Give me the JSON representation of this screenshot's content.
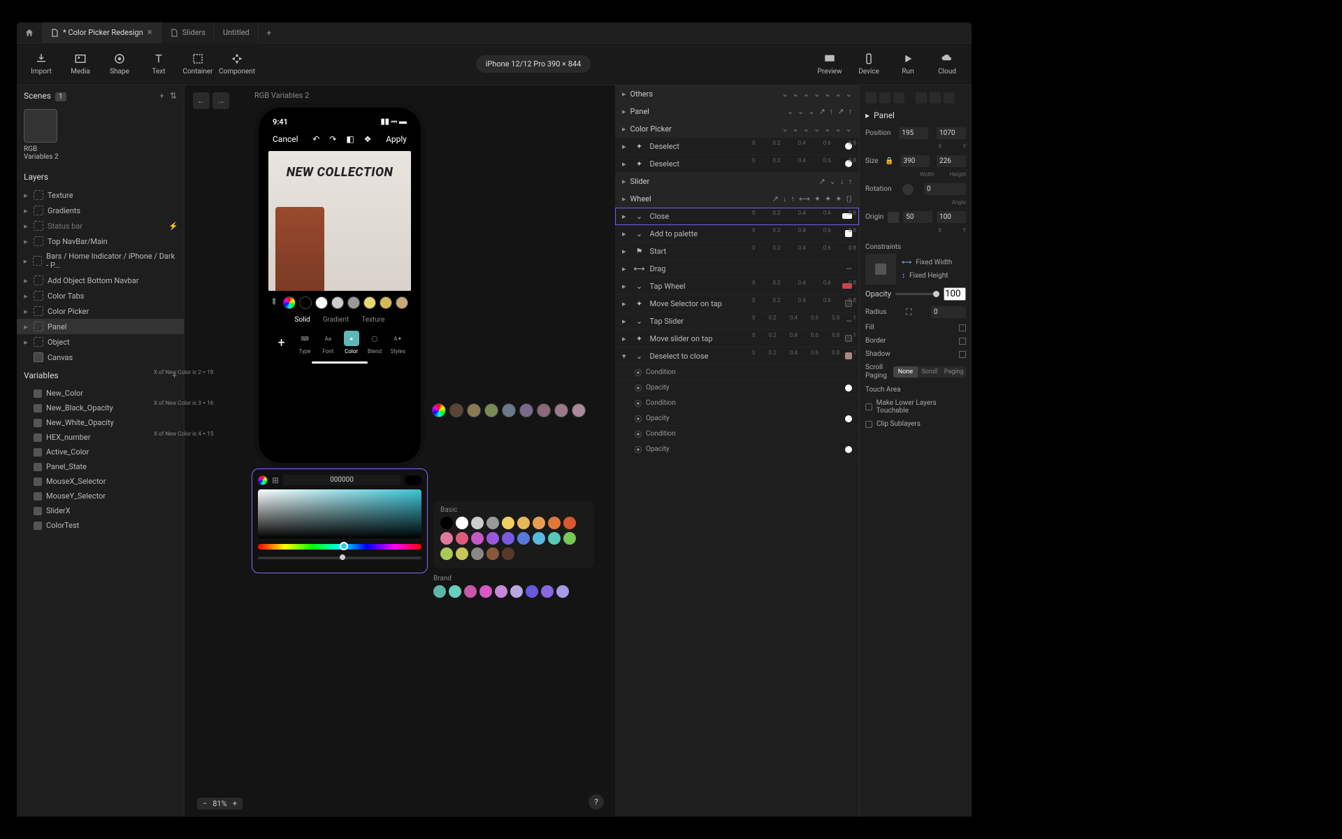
{
  "tabs": {
    "t0": "* Color Picker Redesign",
    "t1": "Sliders",
    "t2": "Untitled"
  },
  "toolbar": {
    "import": "Import",
    "media": "Media",
    "shape": "Shape",
    "text": "Text",
    "container": "Container",
    "component": "Component",
    "preview": "Preview",
    "device": "Device",
    "run": "Run",
    "cloud": "Cloud"
  },
  "device_pill": "iPhone 12/12 Pro  390 × 844",
  "scenes": {
    "title": "Scenes",
    "count": "1",
    "thumb": "RGB Variables 2"
  },
  "layers": {
    "title": "Layers",
    "items": [
      "Texture",
      "Gradients",
      "Status bar",
      "Top NavBar/Main",
      "Bars / Home Indicator / iPhone / Dark - P...",
      "Add Object Bottom Navbar",
      "Color Tabs",
      "Color Picker",
      "Panel",
      "Object",
      "Canvas"
    ]
  },
  "variables": {
    "title": "Variables",
    "items": [
      "New_Color",
      "New_Black_Opacity",
      "New_White_Opacity",
      "HEX_number",
      "Active_Color",
      "Panel_State",
      "MouseX_Selector",
      "MouseY_Selector",
      "SliderX",
      "ColorTest"
    ]
  },
  "canvas": {
    "scene_label": "RGB Variables 2",
    "time": "9:41",
    "cancel": "Cancel",
    "apply": "Apply",
    "hero": "NEW COLLECTION",
    "fill": {
      "solid": "Solid",
      "gradient": "Gradient",
      "texture": "Texture"
    },
    "tools": {
      "type": "Type",
      "font": "Font",
      "color": "Color",
      "blend": "Blend",
      "styles": "Styles"
    },
    "hex": "000000",
    "basic": "Basic",
    "brand": "Brand",
    "zoom": "81%"
  },
  "mid": {
    "others": "Others",
    "panel": "Panel",
    "colorpicker": "Color Picker",
    "deselect": "Deselect",
    "slider": "Slider",
    "wheel": "Wheel",
    "close": "Close",
    "addpalette": "Add to palette",
    "start": "Start",
    "drag": "Drag",
    "tapwheel": "Tap Wheel",
    "movesel": "Move Selector on tap",
    "tapslider": "Tap Slider",
    "moveslider": "Move slider on tap",
    "deselclose": "Deselect to close",
    "condition": "Condition",
    "opacity": "Opacity",
    "ticks": [
      "0",
      "0.2",
      "0.4",
      "0.6",
      "0.8"
    ],
    "ticks2": [
      "0",
      "0.2",
      "0.4",
      "0.6",
      "0.8",
      "1"
    ],
    "cond2": "X of New Color ic 2 = 18",
    "cond3": "X of New Color ic 3 = 16",
    "cond4": "X of New Color ic 4 = 15"
  },
  "right": {
    "panel": "Panel",
    "position": "Position",
    "px": "195",
    "py": "1070",
    "xl": "X",
    "yl": "Y",
    "size": "Size",
    "w": "390",
    "h": "226",
    "wl": "Width",
    "hl": "Height",
    "rotation": "Rotation",
    "rot": "0",
    "angle": "Angle",
    "origin": "Origin",
    "ox": "50",
    "oy": "100",
    "constraints": "Constraints",
    "fixedw": "Fixed Width",
    "fixedh": "Fixed Height",
    "opacity": "Opacity",
    "opv": "100",
    "radius": "Radius",
    "rv": "0",
    "fill": "Fill",
    "border": "Border",
    "shadow": "Shadow",
    "scroll": "Scroll Paging",
    "none": "None",
    "scrolllbl": "Scroll",
    "paging": "Paging",
    "touch": "Touch Area",
    "makelow": "Make Lower Layers Touchable",
    "clip": "Clip Sublayers"
  },
  "palette": {
    "top": [
      "#000",
      "#fff",
      "#ccc",
      "#999",
      "#e8d872",
      "#d4b85a",
      "#c8a878"
    ],
    "extra": [
      "#5a4438",
      "#8a7a54",
      "#7a8a54",
      "#6a7a8a",
      "#7a6a8a",
      "#8a6a7a",
      "#9a7a8a",
      "#a88a9a"
    ],
    "basic1": [
      "#000",
      "#fff",
      "#ccc",
      "#999",
      "#f0d060",
      "#e8b858",
      "#e8a050",
      "#e07838",
      "#d85830"
    ],
    "basic2": [
      "#e07a9a",
      "#e05a7a",
      "#c858c8",
      "#9a58e0",
      "#7a58e0",
      "#5878e0",
      "#58b8e0",
      "#58c8b8",
      "#78c858"
    ],
    "basic3": [
      "#a8c858",
      "#c8c858",
      "#888",
      "#8a5838",
      "#5a3828"
    ],
    "brand": [
      "#5ab8a8",
      "#68d0c0",
      "#c858a8",
      "#d858c8",
      "#c888d8",
      "#b8a8e0",
      "#6858e0",
      "#8868e0",
      "#a898e8"
    ]
  }
}
